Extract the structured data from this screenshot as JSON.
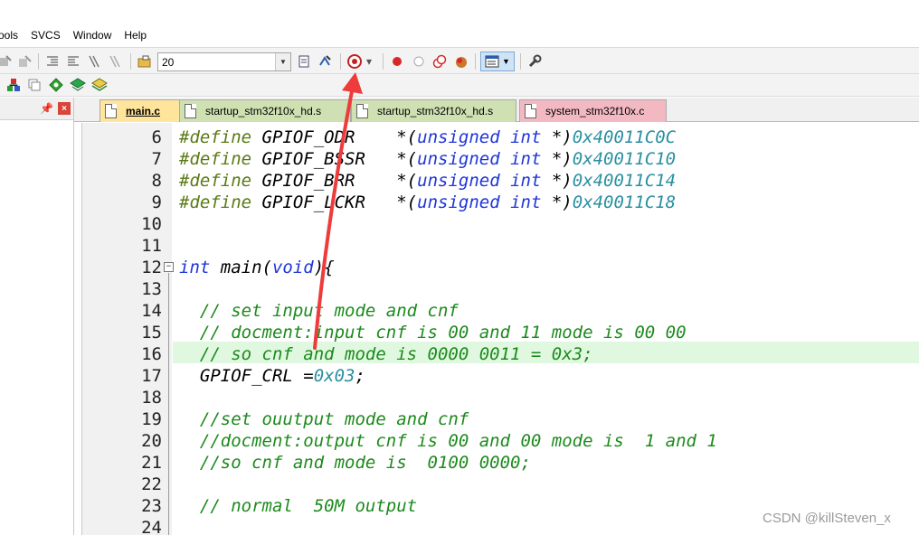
{
  "menu": {
    "items": [
      "ools",
      "SVCS",
      "Window",
      "Help"
    ]
  },
  "toolbar": {
    "target_combo": "20",
    "icons": [
      "build-icon",
      "rebuild-icon",
      "indent-icon",
      "unindent-icon",
      "comment-icon",
      "open-folder-icon",
      "translate-icon",
      "download-icon",
      "debug-icon",
      "breakpoint-icon",
      "disable-breakpoint-icon",
      "kill-breakpoints-icon",
      "settings-icon",
      "window-view-icon",
      "wrench-icon"
    ]
  },
  "toolbar2": {
    "icons": [
      "load-icon",
      "build-target-icon",
      "green-diamond-icon",
      "flash-icon",
      "batch-icon"
    ]
  },
  "panel": {
    "pin": "ꟼ",
    "close": "×"
  },
  "tabs": [
    {
      "label": "main.c",
      "kind": "active"
    },
    {
      "label": "startup_stm32f10x_hd.s",
      "kind": "asm"
    },
    {
      "label": "startup_stm32f10x_hd.s",
      "kind": "asm"
    },
    {
      "label": "system_stm32f10x.c",
      "kind": "csys"
    }
  ],
  "editor": {
    "line_numbers": [
      "6",
      "7",
      "8",
      "9",
      "10",
      "11",
      "12",
      "13",
      "14",
      "15",
      "16",
      "17",
      "18",
      "19",
      "20",
      "21",
      "22",
      "23",
      "24"
    ],
    "fold_marker": "⊟",
    "lines": [
      {
        "pp": "#define",
        "name": " GPIOF_ODR    ",
        "cast_open": "*(",
        "kw": "unsigned int",
        "cast_close": " *)",
        "addr": "0x40011C0C"
      },
      {
        "pp": "#define",
        "name": " GPIOF_BSSR   ",
        "cast_open": "*(",
        "kw": "unsigned int",
        "cast_close": " *)",
        "addr": "0x40011C10"
      },
      {
        "pp": "#define",
        "name": " GPIOF_BRR    ",
        "cast_open": "*(",
        "kw": "unsigned int",
        "cast_close": " *)",
        "addr": "0x40011C14"
      },
      {
        "pp": "#define",
        "name": " GPIOF_LCKR   ",
        "cast_open": "*(",
        "kw": "unsigned int",
        "cast_close": " *)",
        "addr": "0x40011C18"
      }
    ],
    "main_sig": {
      "kw_int": "int",
      "name": " main(",
      "kw_void": "void",
      "tail": "){"
    },
    "comments": {
      "c14": "  // set input mode and cnf",
      "c15": "  // docment:input cnf is 00 and 11 mode is 00 00",
      "c16": "  // so cnf and mode is 0000 0011 = 0x3;",
      "c19": "  //set ouutput mode and cnf",
      "c20": "  //docment:output cnf is 00 and 00 mode is  1 and 1",
      "c21": "  //so cnf and mode is  0100 0000;",
      "c23": "  // normal  50M output"
    },
    "assign17": {
      "lhs": "  GPIOF_CRL =",
      "val": "0x03",
      "end": ";"
    }
  },
  "watermark": "CSDN @killSteven_x",
  "colors": {
    "annotation_arrow": "#ee3b3b",
    "highlight_line": "#e0f8e0",
    "tab_active": "#ffe49b",
    "tab_asm": "#cfe0b2",
    "tab_csys": "#f3b9c3"
  }
}
